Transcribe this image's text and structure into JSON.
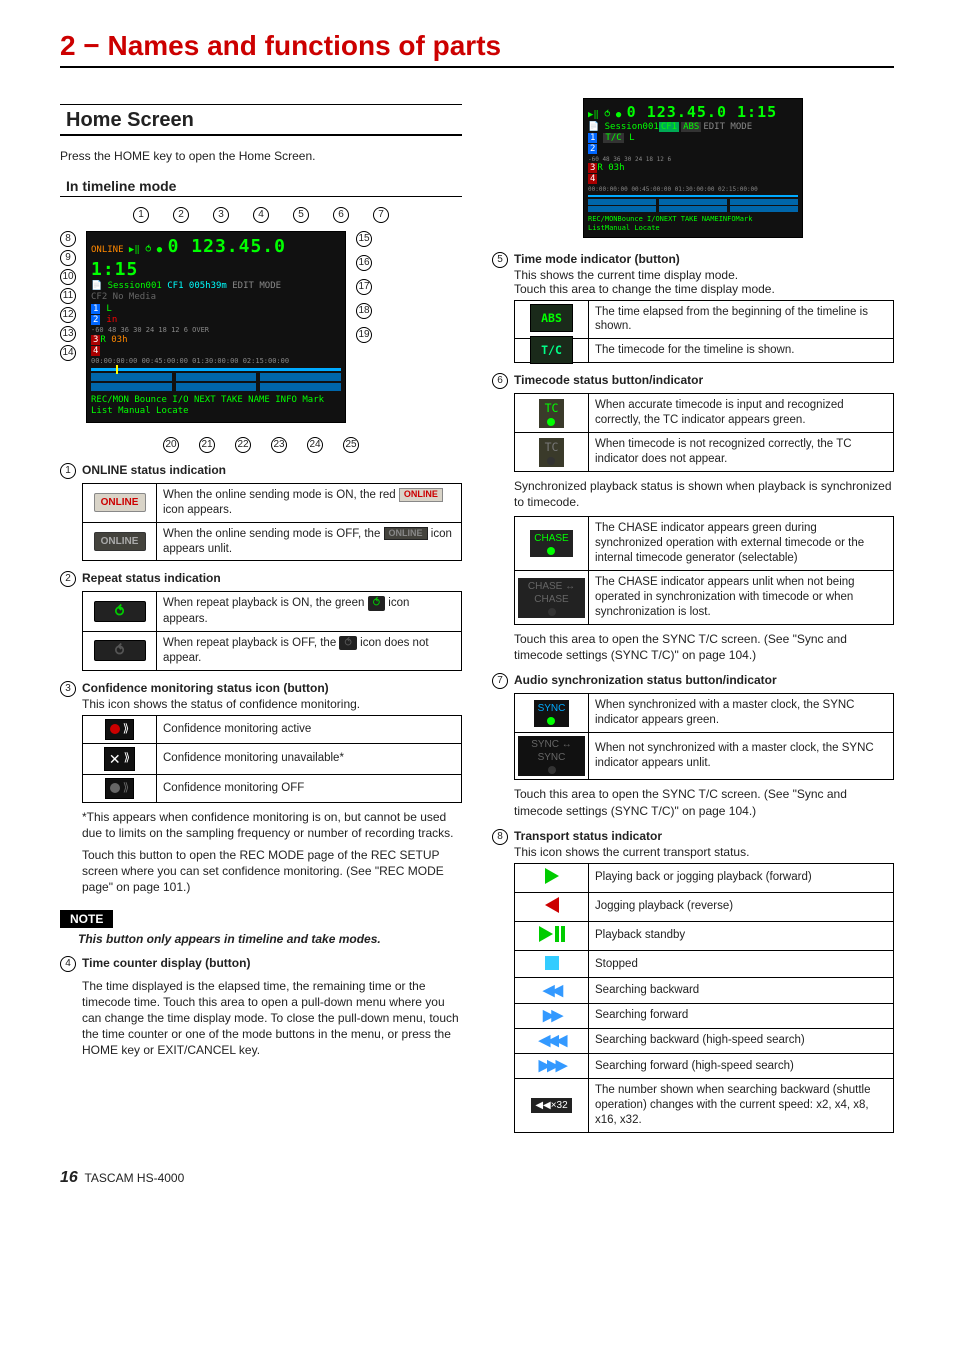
{
  "chapter": "2 − Names and functions of parts",
  "section": "Home Screen",
  "intro": "Press the HOME key to open the Home Screen.",
  "subsection": "In timeline mode",
  "callouts_top": [
    "1",
    "2",
    "3",
    "4",
    "5",
    "6",
    "7"
  ],
  "callouts_left": [
    "8",
    "9",
    "10",
    "11",
    "12",
    "13",
    "14"
  ],
  "callouts_right": [
    "15",
    "16",
    "17",
    "18",
    "19"
  ],
  "callouts_bottom": [
    "20",
    "21",
    "22",
    "23",
    "24",
    "25"
  ],
  "diagram": {
    "title_row": "ONLINE",
    "big_time": "0 123.45.0 1:15",
    "session": "Session001",
    "cf": "CF1  005h39m",
    "cf2": "CF2  No Media",
    "edit_mode": "EDIT MODE",
    "meter_scale": "-60  48  36    30    24     18     12      6    OVER",
    "tracks": [
      "1",
      "2",
      "3",
      "4"
    ],
    "ruler": "00:00:00:00   00:45:00:00   01:30:00:00   02:15:00:00",
    "buttons": [
      "REC/MON",
      "Bounce I/O",
      "NEXT TAKE NAME",
      "INFO",
      "Mark List",
      "Manual Locate"
    ],
    "side": {
      "L": "L",
      "R": "R",
      "in": "in",
      "03h": "03h"
    }
  },
  "right_diagram": {
    "big_time": "0 123.45.0 1:15",
    "session": "Session001",
    "cf1": "CF1",
    "abs": "ABS",
    "edit": "EDIT MODE",
    "tc": "T/C",
    "meter": "-60  48  36    30    24     18     12      6",
    "ruler": "00:00:00:00   00:45:00:00   01:30:00:00   02:15:00:00",
    "buttons": [
      "REC/MON",
      "Bounce I/O",
      "NEXT TAKE NAME",
      "INFO",
      "Mark List",
      "Manual Locate"
    ]
  },
  "items": {
    "i1": {
      "num": "1",
      "title": "ONLINE status indication",
      "rows": [
        {
          "icon": "ONLINE",
          "cls": "online-on",
          "text_pre": "When the online sending mode is ON, the red ",
          "text_post": " icon appears.",
          "inline": "ONLINE",
          "inline_cls": "inline-icon-red"
        },
        {
          "icon": "ONLINE",
          "cls": "online-off",
          "text_pre": "When the online sending mode is OFF, the ",
          "text_post": " icon appears unlit.",
          "inline": "ONLINE",
          "inline_cls": "inline-icon-dark"
        }
      ]
    },
    "i2": {
      "num": "2",
      "title": "Repeat status indication",
      "rows": [
        {
          "icon": "⥀",
          "cls": "repeat-on",
          "text_pre": "When repeat playback is ON, the green ",
          "text_post": " icon appears.",
          "inline": "⥀",
          "inline_cls": "inline-rep-on"
        },
        {
          "icon": "⥀",
          "cls": "repeat-off",
          "text_pre": "When repeat playback is OFF, the ",
          "text_post": " icon does not appear.",
          "inline": "⥀",
          "inline_cls": "inline-rep-off"
        }
      ]
    },
    "i3": {
      "num": "3",
      "title": "Confidence monitoring status icon (button)",
      "sub": "This icon shows the status of confidence monitoring.",
      "rows": [
        {
          "icon": "●⟫",
          "text": "Confidence monitoring active"
        },
        {
          "icon": "✕⟫",
          "text": "Confidence monitoring unavailable*"
        },
        {
          "icon": "●⟫",
          "text": "Confidence monitoring OFF"
        }
      ],
      "foot": "*This appears when confidence monitoring is on, but cannot be used due to limits on the sampling frequency or number of recording tracks.",
      "foot2": "Touch this button to open the REC MODE page of the REC SETUP screen where you can set confidence monitoring. (See \"REC MODE page\" on page 101.)"
    },
    "note_label": "NOTE",
    "note_text": "This button only appears in timeline and take modes.",
    "i4": {
      "num": "4",
      "title": "Time counter display (button)",
      "body": "The time displayed is the elapsed time, the remaining time or the timecode time. Touch this area to open a pull-down menu where you can change the time display mode. To close the pull-down menu, touch the time counter or one of the mode buttons in the menu, or press the HOME key or EXIT/CANCEL key."
    },
    "i5": {
      "num": "5",
      "title": "Time mode indicator (button)",
      "body": "This shows the current time display mode.",
      "body2": "Touch this area to change the time display mode.",
      "rows": [
        {
          "icon": "ABS",
          "cls": "abs-box",
          "text": "The time elapsed from the beginning of the timeline is shown."
        },
        {
          "icon": "T/C",
          "cls": "tc-box",
          "text": "The timecode for the timeline is shown."
        }
      ]
    },
    "i6": {
      "num": "6",
      "title": "Timecode status button/indicator",
      "rows": [
        {
          "icon": "TC",
          "led": "led-green",
          "text": "When accurate timecode is input and recognized correctly, the TC indicator appears green."
        },
        {
          "icon": "TC",
          "led": "led-off",
          "text": "When timecode is not recognized correctly, the TC indicator does not appear."
        }
      ],
      "mid": "Synchronized playback status is shown when playback is synchronized to timecode.",
      "rows2": [
        {
          "icon": "CHASE",
          "led": "led-green",
          "text": "The CHASE indicator appears green during synchronized operation with external timecode or the internal timecode generator (selectable)"
        },
        {
          "icon": "CHASE ↔ CHASE",
          "led": "led-off",
          "text": "The CHASE indicator appears unlit when not being operated in synchronization with timecode or when synchronization is lost."
        }
      ],
      "foot": "Touch this area to open the SYNC T/C screen. (See \"Sync and timecode settings (SYNC T/C)\" on page 104.)"
    },
    "i7": {
      "num": "7",
      "title": "Audio synchronization status button/indicator",
      "rows": [
        {
          "icon": "SYNC",
          "led": "led-green",
          "text": "When synchronized with a master clock, the SYNC indicator appears green."
        },
        {
          "icon": "SYNC ↔ SYNC",
          "led": "led-off",
          "text": "When not synchronized with a master clock, the SYNC indicator appears unlit."
        }
      ],
      "foot": "Touch this area to open the SYNC T/C screen. (See \"Sync and timecode settings (SYNC T/C)\" on page 104.)"
    },
    "i8": {
      "num": "8",
      "title": "Transport status indicator",
      "sub": "This icon shows the current transport status.",
      "rows": [
        {
          "k": "play",
          "text": "Playing back or jogging playback (forward)"
        },
        {
          "k": "playrev",
          "text": "Jogging playback (reverse)"
        },
        {
          "k": "playpause",
          "text": "Playback standby"
        },
        {
          "k": "stop",
          "text": "Stopped"
        },
        {
          "k": "rew",
          "text": "Searching backward"
        },
        {
          "k": "ff",
          "text": "Searching forward"
        },
        {
          "k": "rew3",
          "text": "Searching backward (high-speed search)"
        },
        {
          "k": "ff3",
          "text": "Searching forward (high-speed search)"
        },
        {
          "k": "shuttle",
          "label": "◀◀×32",
          "text": "The number shown when searching backward (shuttle operation) changes with the current speed: x2, x4, x8, x16, x32."
        }
      ]
    }
  },
  "footer": {
    "page": "16",
    "model": "TASCAM  HS-4000"
  }
}
